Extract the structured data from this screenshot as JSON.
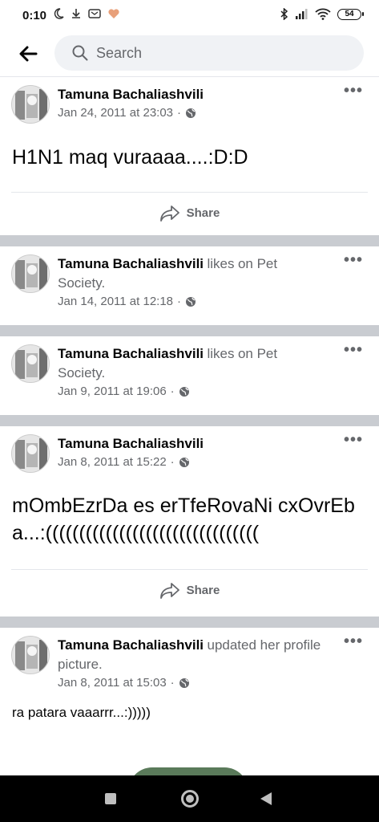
{
  "status_bar": {
    "time": "0:10",
    "battery": "54"
  },
  "search": {
    "placeholder": "Search"
  },
  "posts": [
    {
      "author": "Tamuna Bachaliashvili",
      "action": "",
      "action2": "",
      "date": "Jan 24, 2011 at 23:03",
      "text": "H1N1 maq vuraaaa....:D:D",
      "share_label": "Share"
    },
    {
      "author": "Tamuna Bachaliashvili",
      "action": "likes",
      "action2": "on Pet Society.",
      "date": "Jan 14, 2011 at 12:18"
    },
    {
      "author": "Tamuna Bachaliashvili",
      "action": "likes",
      "action2": "on Pet Society.",
      "date": "Jan 9, 2011 at 19:06"
    },
    {
      "author": "Tamuna Bachaliashvili",
      "action": "",
      "action2": "",
      "date": "Jan 8, 2011 at 15:22",
      "text": "mOmbEzrDa es erTfeRovaNi cxOvrEba...:((((((((((((((((((((((((((((((((",
      "share_label": "Share"
    },
    {
      "author": "Tamuna Bachaliashvili",
      "action": "updated her profile picture.",
      "action2": "",
      "date": "Jan 8, 2011 at 15:03",
      "text": "ra patara vaaarrr...:)))))"
    }
  ],
  "icons": {
    "globe": "globe-icon",
    "share": "share-icon",
    "more": "more-icon"
  }
}
